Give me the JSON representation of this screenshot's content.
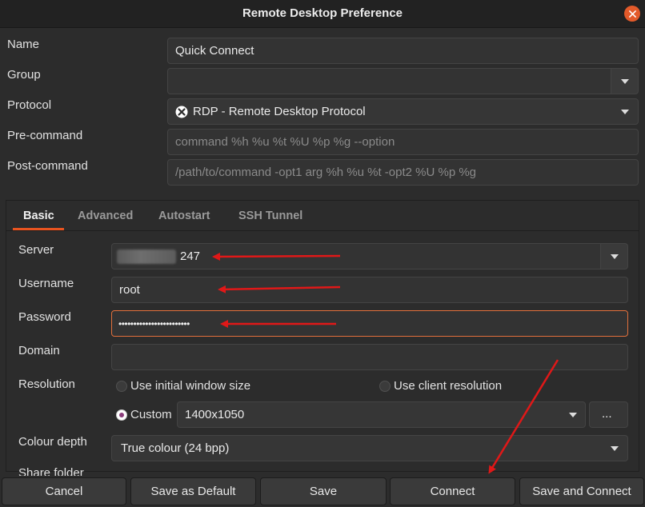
{
  "window": {
    "title": "Remote Desktop Preference"
  },
  "colors": {
    "accent": "#e95420",
    "annotation_arrow": "#e01818",
    "radio_checked": "#8a3b7a"
  },
  "profile": {
    "name_label": "Name",
    "name_value": "Quick Connect",
    "group_label": "Group",
    "group_value": "",
    "protocol_label": "Protocol",
    "protocol_value": "RDP - Remote Desktop Protocol",
    "protocol_icon": "rdp-protocol-icon",
    "precommand_label": "Pre-command",
    "precommand_placeholder": "command %h %u %t %U %p %g --option",
    "postcommand_label": "Post-command",
    "postcommand_placeholder": "/path/to/command -opt1 arg %h %u %t -opt2 %U %p %g"
  },
  "tabs": [
    {
      "label": "Basic",
      "active": true
    },
    {
      "label": "Advanced",
      "active": false
    },
    {
      "label": "Autostart",
      "active": false
    },
    {
      "label": "SSH Tunnel",
      "active": false
    }
  ],
  "basic": {
    "server_label": "Server",
    "server_value_visible": "247",
    "username_label": "Username",
    "username_value": "root",
    "password_label": "Password",
    "password_mask": "••••••••••••••••••••••••",
    "domain_label": "Domain",
    "domain_value": "",
    "resolution_label": "Resolution",
    "resolution_initial": "Use initial window size",
    "resolution_client": "Use client resolution",
    "resolution_custom": "Custom",
    "resolution_custom_value": "1400x1050",
    "resolution_more": "...",
    "colour_label": "Colour depth",
    "colour_value": "True colour (24 bpp)",
    "share_folder_label": "Share folder"
  },
  "buttons": {
    "cancel": "Cancel",
    "save_default": "Save as Default",
    "save": "Save",
    "connect": "Connect",
    "save_connect": "Save and Connect"
  }
}
